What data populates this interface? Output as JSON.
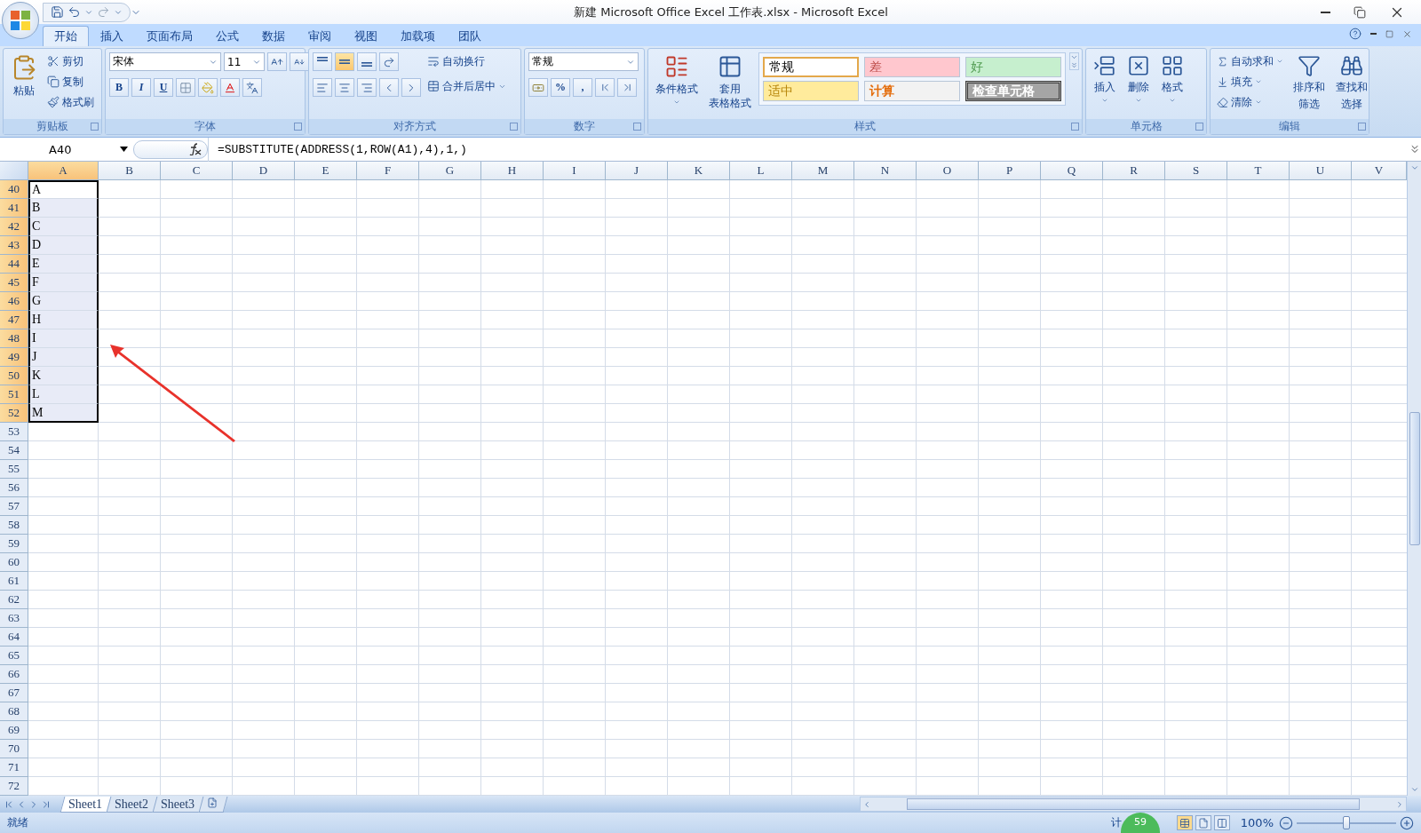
{
  "window": {
    "title": "新建 Microsoft Office Excel 工作表.xlsx - Microsoft Excel"
  },
  "tabs": [
    {
      "label": "开始",
      "selected": true
    },
    {
      "label": "插入",
      "selected": false
    },
    {
      "label": "页面布局",
      "selected": false
    },
    {
      "label": "公式",
      "selected": false
    },
    {
      "label": "数据",
      "selected": false
    },
    {
      "label": "审阅",
      "selected": false
    },
    {
      "label": "视图",
      "selected": false
    },
    {
      "label": "加载项",
      "selected": false
    },
    {
      "label": "团队",
      "selected": false
    }
  ],
  "ribbon": {
    "clipboard": {
      "label": "剪贴板",
      "paste": "粘贴",
      "items": [
        "剪切",
        "复制",
        "格式刷"
      ]
    },
    "font": {
      "label": "字体",
      "name": "宋体",
      "size": "11",
      "styles": [
        "B",
        "I",
        "U"
      ]
    },
    "alignment": {
      "label": "对齐方式",
      "valign": [
        {
          "selected": false
        },
        {
          "selected": true
        },
        {
          "selected": false
        }
      ],
      "wrap": "自动换行",
      "merge": "合并后居中"
    },
    "number": {
      "label": "数字",
      "format": "常规",
      "symbols": [
        "%",
        ","
      ]
    },
    "styles": {
      "label": "样式",
      "conditional": "条件格式",
      "table": [
        "套用",
        "表格格式"
      ],
      "cells": [
        {
          "label": "常规",
          "kind": "normal",
          "selected": true
        },
        {
          "label": "差",
          "kind": "bad",
          "selected": false
        },
        {
          "label": "好",
          "kind": "good",
          "selected": false
        },
        {
          "label": "适中",
          "kind": "neutral",
          "selected": false
        },
        {
          "label": "计算",
          "kind": "calculation",
          "selected": false
        },
        {
          "label": "检查单元格",
          "kind": "check",
          "selected": false
        }
      ]
    },
    "cells": {
      "label": "单元格",
      "buttons": [
        {
          "label": "插入",
          "kind": "insert"
        },
        {
          "label": "删除",
          "kind": "delete"
        },
        {
          "label": "格式",
          "kind": "format"
        }
      ]
    },
    "editing": {
      "label": "编辑",
      "items": [
        {
          "label": "自动求和",
          "kind": "sum"
        },
        {
          "label": "填充",
          "kind": "fill"
        },
        {
          "label": "清除",
          "kind": "clear"
        }
      ],
      "big": [
        {
          "lines": [
            "排序和",
            "筛选"
          ],
          "kind": "sort"
        },
        {
          "lines": [
            "查找和",
            "选择"
          ],
          "kind": "find"
        }
      ]
    }
  },
  "formula_bar": {
    "name_box": "A40",
    "formula": "=SUBSTITUTE(ADDRESS(1,ROW(A1),4),1,)"
  },
  "columns": [
    {
      "label": "A",
      "selected": true
    },
    {
      "label": "B",
      "selected": false
    },
    {
      "label": "C",
      "selected": false
    },
    {
      "label": "D",
      "selected": false
    },
    {
      "label": "E",
      "selected": false
    },
    {
      "label": "F",
      "selected": false
    },
    {
      "label": "G",
      "selected": false
    },
    {
      "label": "H",
      "selected": false
    },
    {
      "label": "I",
      "selected": false
    },
    {
      "label": "J",
      "selected": false
    },
    {
      "label": "K",
      "selected": false
    },
    {
      "label": "L",
      "selected": false
    },
    {
      "label": "M",
      "selected": false
    },
    {
      "label": "N",
      "selected": false
    },
    {
      "label": "O",
      "selected": false
    },
    {
      "label": "P",
      "selected": false
    },
    {
      "label": "Q",
      "selected": false
    },
    {
      "label": "R",
      "selected": false
    },
    {
      "label": "S",
      "selected": false
    },
    {
      "label": "T",
      "selected": false
    },
    {
      "label": "U",
      "selected": false
    },
    {
      "label": "V",
      "selected": false
    }
  ],
  "rows": [
    {
      "header": "40",
      "selected": true,
      "value": "A"
    },
    {
      "header": "41",
      "selected": true,
      "value": "B"
    },
    {
      "header": "42",
      "selected": true,
      "value": "C"
    },
    {
      "header": "43",
      "selected": true,
      "value": "D"
    },
    {
      "header": "44",
      "selected": true,
      "value": "E"
    },
    {
      "header": "45",
      "selected": true,
      "value": "F"
    },
    {
      "header": "46",
      "selected": true,
      "value": "G"
    },
    {
      "header": "47",
      "selected": true,
      "value": "H"
    },
    {
      "header": "48",
      "selected": true,
      "value": "I"
    },
    {
      "header": "49",
      "selected": true,
      "value": "J"
    },
    {
      "header": "50",
      "selected": true,
      "value": "K"
    },
    {
      "header": "51",
      "selected": true,
      "value": "L"
    },
    {
      "header": "52",
      "selected": true,
      "value": "M"
    },
    {
      "header": "53",
      "selected": false
    },
    {
      "header": "54",
      "selected": false
    },
    {
      "header": "55",
      "selected": false
    },
    {
      "header": "56",
      "selected": false
    },
    {
      "header": "57",
      "selected": false
    },
    {
      "header": "58",
      "selected": false
    },
    {
      "header": "59",
      "selected": false
    },
    {
      "header": "60",
      "selected": false
    },
    {
      "header": "61",
      "selected": false
    },
    {
      "header": "62",
      "selected": false
    },
    {
      "header": "63",
      "selected": false
    },
    {
      "header": "64",
      "selected": false
    },
    {
      "header": "65",
      "selected": false
    },
    {
      "header": "66",
      "selected": false
    },
    {
      "header": "67",
      "selected": false
    },
    {
      "header": "68",
      "selected": false
    },
    {
      "header": "69",
      "selected": false
    },
    {
      "header": "70",
      "selected": false
    },
    {
      "header": "71",
      "selected": false
    },
    {
      "header": "72",
      "selected": false
    }
  ],
  "sheets": [
    {
      "label": "Sheet1",
      "selected": true
    },
    {
      "label": "Sheet2",
      "selected": false
    },
    {
      "label": "Sheet3",
      "selected": false
    }
  ],
  "status_bar": {
    "state": "就绪",
    "summary": "计",
    "badge": "59",
    "views": [
      {
        "kind": "normal",
        "selected": true
      },
      {
        "kind": "layout",
        "selected": false
      },
      {
        "kind": "pagebreak",
        "selected": false
      }
    ],
    "zoom": "100%",
    "zoom_slider": {
      "level": 0.5
    }
  }
}
